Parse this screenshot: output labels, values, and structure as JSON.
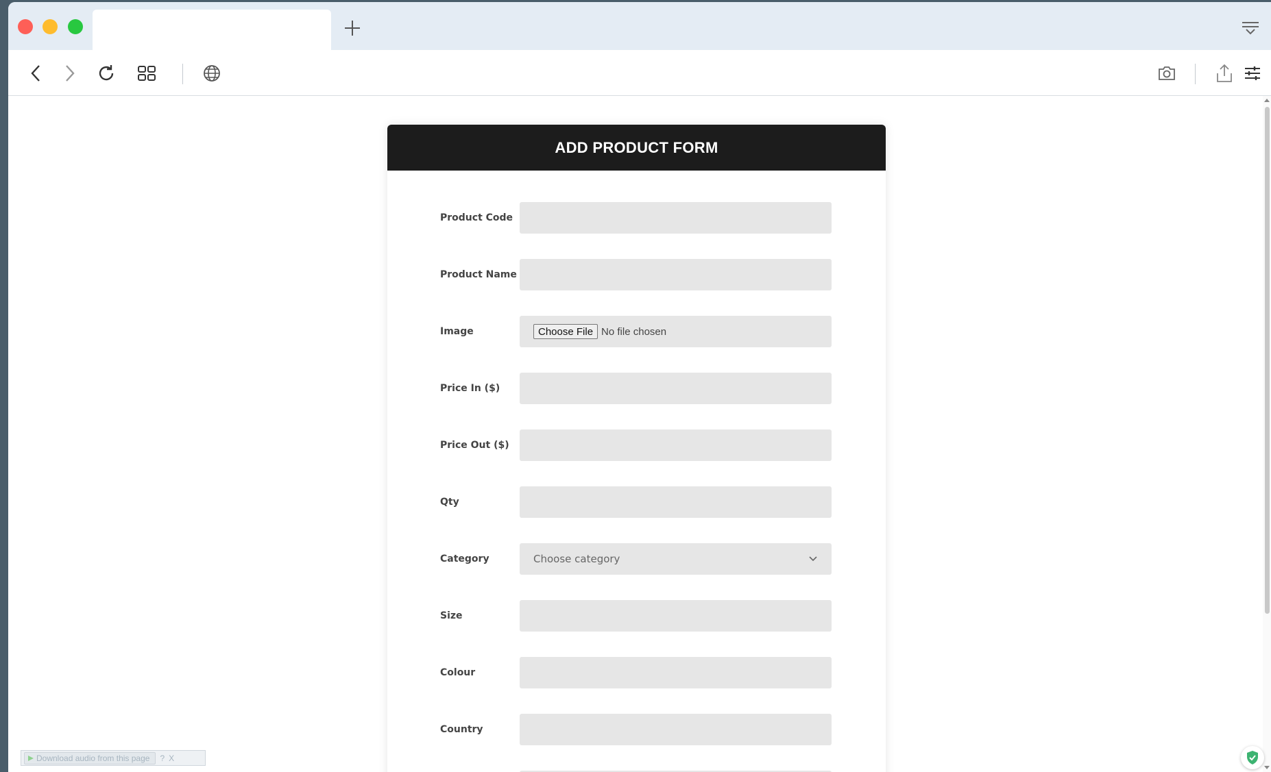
{
  "browser": {
    "tab_title": "",
    "address_text": ""
  },
  "form": {
    "title": "ADD PRODUCT FORM",
    "fields": {
      "product_code": {
        "label": "Product Code",
        "value": ""
      },
      "product_name": {
        "label": "Product Name",
        "value": ""
      },
      "image": {
        "label": "Image",
        "button": "Choose File",
        "status": "No file chosen"
      },
      "price_in": {
        "label": "Price In ($)",
        "value": ""
      },
      "price_out": {
        "label": "Price Out ($)",
        "value": ""
      },
      "qty": {
        "label": "Qty",
        "value": ""
      },
      "category": {
        "label": "Category",
        "selected": "Choose category"
      },
      "size": {
        "label": "Size",
        "value": ""
      },
      "colour": {
        "label": "Colour",
        "value": ""
      },
      "country": {
        "label": "Country",
        "value": ""
      }
    }
  },
  "extension": {
    "download_audio_label": "Download audio from this page",
    "help": "?",
    "close": "X"
  },
  "colors": {
    "header_bg": "#1c1c1c",
    "input_bg": "#e6e6e6",
    "tabbar_bg": "#e4ecf4",
    "shield": "#3cb371"
  },
  "icons": {
    "toolbar": [
      "back-icon",
      "forward-icon",
      "reload-icon",
      "grid-icon",
      "globe-icon",
      "camera-icon",
      "share-icon",
      "settings-sliders-icon"
    ]
  }
}
